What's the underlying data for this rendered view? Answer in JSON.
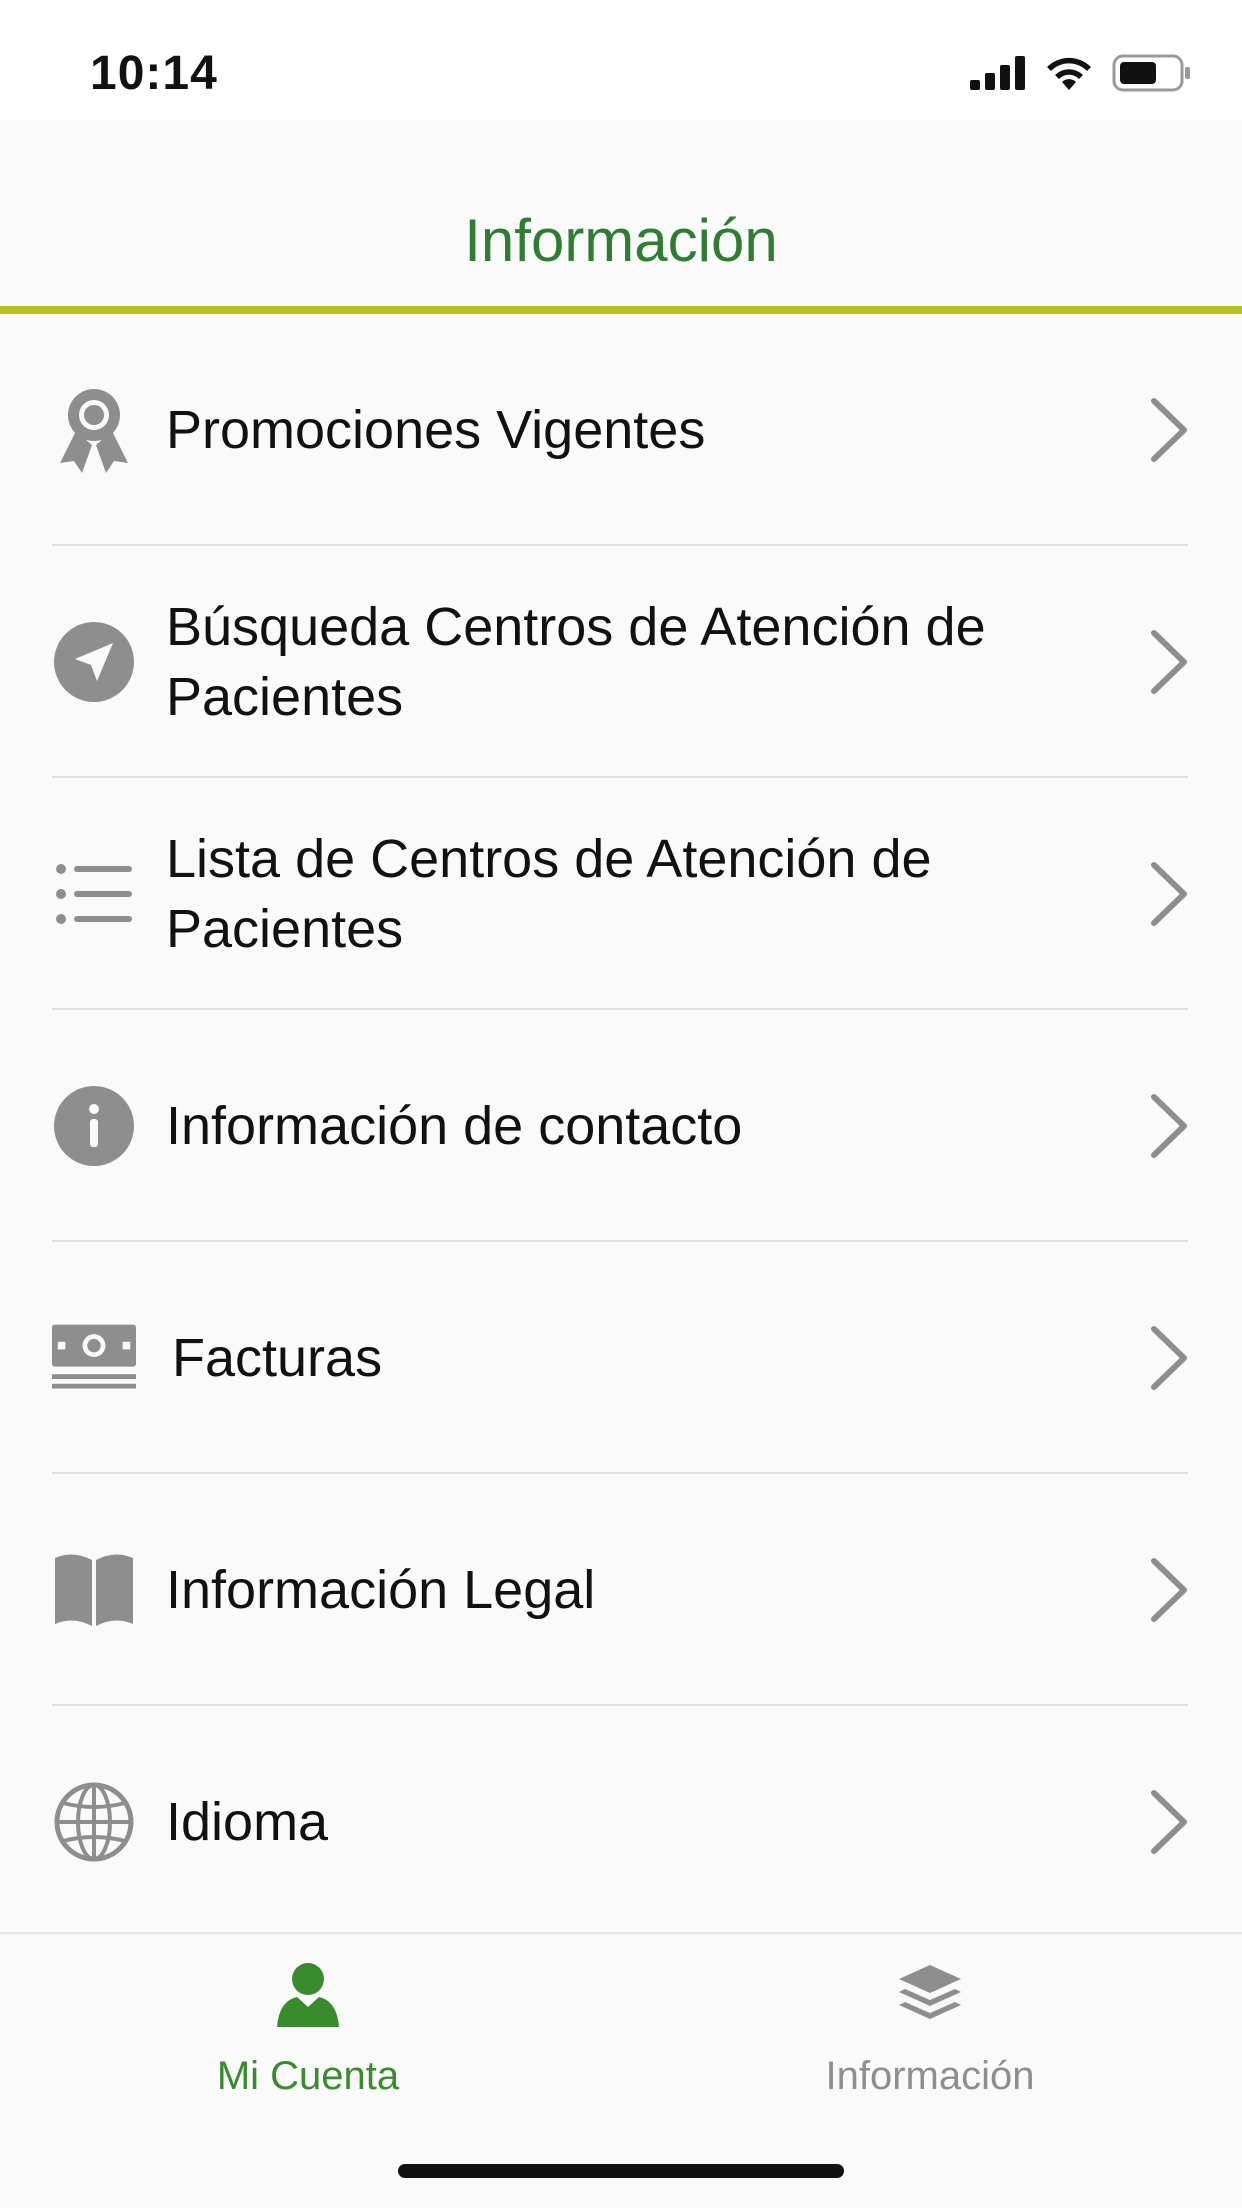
{
  "status_bar": {
    "time": "10:14"
  },
  "header": {
    "title": "Información",
    "accent_color": "#b5c21a",
    "title_color": "#2e7d32"
  },
  "menu": {
    "items": [
      {
        "label": "Promociones Vigentes",
        "icon": "award-ribbon-icon"
      },
      {
        "label": "Búsqueda Centros de Atención de Pacientes",
        "icon": "location-arrow-icon"
      },
      {
        "label": "Lista de Centros de Atención de Pacientes",
        "icon": "list-icon"
      },
      {
        "label": "Información de contacto",
        "icon": "info-icon"
      },
      {
        "label": "Facturas",
        "icon": "money-bill-icon"
      },
      {
        "label": "Información Legal",
        "icon": "book-icon"
      },
      {
        "label": "Idioma",
        "icon": "globe-icon"
      }
    ]
  },
  "tab_bar": {
    "tabs": [
      {
        "label": "Mi Cuenta",
        "icon": "user-icon",
        "active": true,
        "color": "#3a8a2e"
      },
      {
        "label": "Información",
        "icon": "layers-icon",
        "active": false,
        "color": "#8e8e8e"
      }
    ]
  }
}
